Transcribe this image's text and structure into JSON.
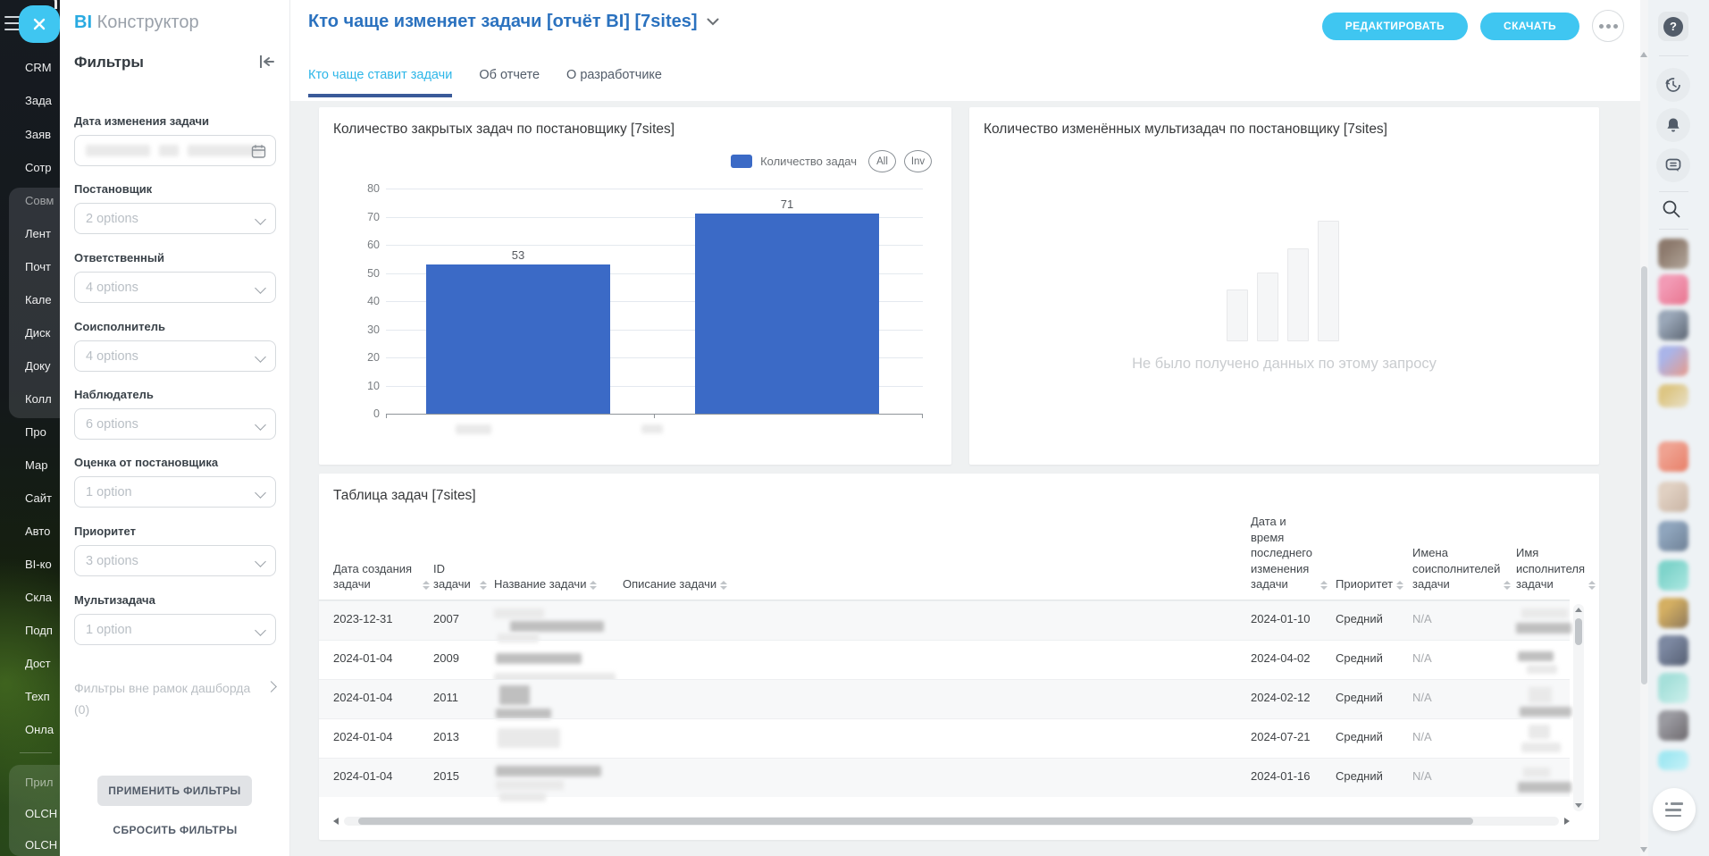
{
  "app": {
    "logo_bi": "BI",
    "logo_name": "Конструктор"
  },
  "left_rail": {
    "menu_items": [
      "CRM",
      "Зада",
      "Заяв",
      "Сотр",
      "Совм",
      "Лент",
      "Почт",
      "Кале",
      "Диск",
      "Доку",
      "Колл",
      "Про",
      "Мар",
      "Сайт",
      "Авто",
      "BI-ко",
      "Скла",
      "Подп",
      "Дост",
      "Техп",
      "Онла"
    ],
    "bottom_items": [
      "Прил",
      "OLCH",
      "OLCH"
    ]
  },
  "filters": {
    "panel_title": "Фильтры",
    "date_field": {
      "label": "Дата изменения задачи",
      "value_redacted": true
    },
    "selects": [
      {
        "label": "Постановщик",
        "value": "2 options"
      },
      {
        "label": "Ответственный",
        "value": "4 options"
      },
      {
        "label": "Соисполнитель",
        "value": "4 options"
      },
      {
        "label": "Наблюдатель",
        "value": "6 options"
      },
      {
        "label": "Оценка от постановщика",
        "value": "1 option"
      },
      {
        "label": "Приоритет",
        "value": "3 options"
      },
      {
        "label": "Мультизадача",
        "value": "1 option"
      }
    ],
    "outer_label": "Фильтры вне рамок дашборда",
    "outer_count": "(0)",
    "apply_label": "ПРИМЕНИТЬ ФИЛЬТРЫ",
    "reset_label": "СБРОСИТЬ ФИЛЬТРЫ"
  },
  "header": {
    "title": "Кто чаще изменяет задачи [отчёт BI] [7sites]",
    "edit_label": "РЕДАКТИРОВАТЬ",
    "download_label": "СКАЧАТЬ"
  },
  "tabs": [
    "Кто чаще ставит задачи",
    "Об отчете",
    "О разработчике"
  ],
  "chart_data": {
    "type": "bar",
    "title": "Количество закрытых задач по постановщику [7sites]",
    "series_name": "Количество задач",
    "categories": [
      "",
      ""
    ],
    "values": [
      53,
      71
    ],
    "ylim": [
      0,
      80
    ],
    "y_ticks": [
      "80",
      "70",
      "60",
      "50",
      "40",
      "30",
      "20",
      "10",
      "0"
    ],
    "grid": true,
    "legend_position": "top-right",
    "toggles": [
      "All",
      "Inv"
    ],
    "bar_color": "#3b6ac6"
  },
  "empty_chart": {
    "title": "Количество изменённых мультизадач по постановщику [7sites]",
    "message": "Не было получено данных по этому запросу"
  },
  "table": {
    "title": "Таблица задач [7sites]",
    "columns": [
      "Дата создания задачи",
      "ID задачи",
      "Название задачи",
      "Описание задачи",
      "Дата и время последнего изменения задачи",
      "Приоритет",
      "Имена соисполнителей задачи",
      "Имя исполнителя задачи"
    ],
    "rows": [
      {
        "created": "2023-12-31",
        "id": "2007",
        "modified": "2024-01-10",
        "priority": "Средний",
        "coexecutors": "N/A"
      },
      {
        "created": "2024-01-04",
        "id": "2009",
        "modified": "2024-04-02",
        "priority": "Средний",
        "coexecutors": "N/A"
      },
      {
        "created": "2024-01-04",
        "id": "2011",
        "modified": "2024-02-12",
        "priority": "Средний",
        "coexecutors": "N/A"
      },
      {
        "created": "2024-01-04",
        "id": "2013",
        "modified": "2024-07-21",
        "priority": "Средний",
        "coexecutors": "N/A"
      },
      {
        "created": "2024-01-04",
        "id": "2015",
        "modified": "2024-01-16",
        "priority": "Средний",
        "coexecutors": "N/A"
      }
    ]
  },
  "right_rail": {
    "help_glyph": "?",
    "avatar_colors": [
      [
        "#8d7a6d",
        "#b3a79b"
      ],
      [
        "#f29ab5",
        "#e8758f"
      ],
      [
        "#9aa7b8",
        "#5d6673"
      ],
      [
        "#aab4e8",
        "#e89a8a"
      ],
      [
        "#ddc684",
        "#e8e0c8"
      ],
      [
        "#efa291",
        "#e87f68"
      ],
      [
        "#e0d0c2",
        "#c9b4a4"
      ],
      [
        "#8fa5bd",
        "#6f8196"
      ],
      [
        "#7fd4cb",
        "#aee8e2"
      ],
      [
        "#d4af62",
        "#8d785a"
      ],
      [
        "#7c88a1",
        "#565f72"
      ],
      [
        "#a6e0da",
        "#cdf0ec"
      ],
      [
        "#9a9aa0",
        "#6e6a6e"
      ],
      [
        "#a2e8f2",
        "#c8f2f8"
      ]
    ]
  },
  "colors": {
    "accent_cyan": "#3fc6f1",
    "title_blue": "#2b72bf",
    "active_tab": "#2db6e8",
    "tab_underline": "#3a5a99"
  }
}
